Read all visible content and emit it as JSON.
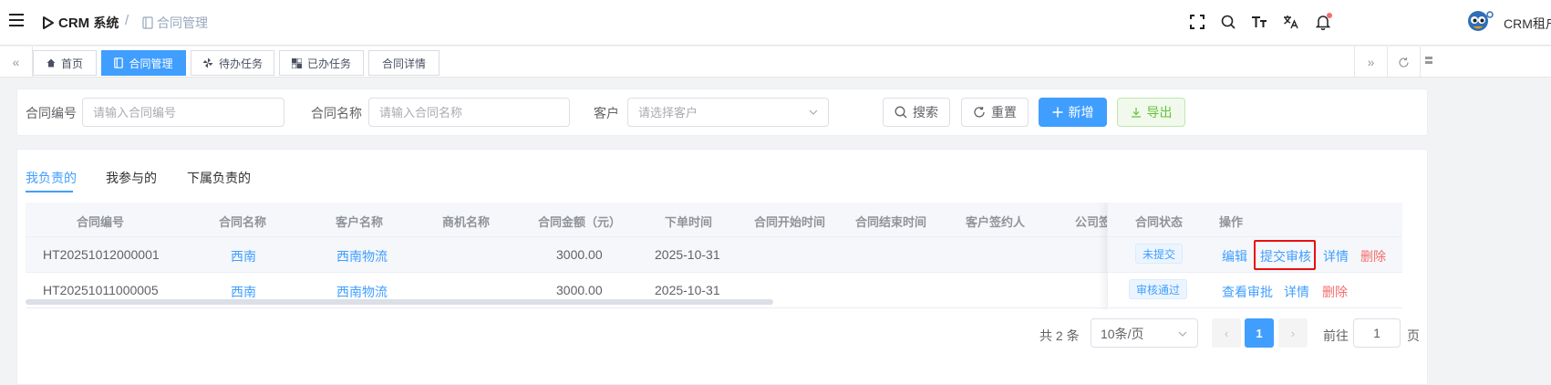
{
  "header": {
    "logo_text": "CRM",
    "logo_suffix": "系统",
    "breadcrumb": "合同管理",
    "user_name": "CRM租户",
    "icons": [
      "fullscreen-icon",
      "search-icon",
      "font-size-icon",
      "translate-icon",
      "bell-icon"
    ]
  },
  "tabs": [
    {
      "label": "首页",
      "icon": "home-icon"
    },
    {
      "label": "合同管理",
      "icon": "document-icon",
      "active": true
    },
    {
      "label": "待办任务",
      "icon": "pinwheel-icon"
    },
    {
      "label": "已办任务",
      "icon": "checkerboard-icon"
    },
    {
      "label": "合同详情",
      "icon": ""
    }
  ],
  "search": {
    "contract_no_label": "合同编号",
    "contract_no_placeholder": "请输入合同编号",
    "contract_name_label": "合同名称",
    "contract_name_placeholder": "请输入合同名称",
    "customer_label": "客户",
    "customer_placeholder": "请选择客户",
    "search_btn": "搜索",
    "reset_btn": "重置",
    "add_btn": "新增",
    "export_btn": "导出"
  },
  "subtabs": [
    "我负责的",
    "我参与的",
    "下属负责的"
  ],
  "table": {
    "columns": [
      "合同编号",
      "合同名称",
      "客户名称",
      "商机名称",
      "合同金额（元）",
      "下单时间",
      "合同开始时间",
      "合同结束时间",
      "客户签约人",
      "公司签",
      "合同状态",
      "操作"
    ],
    "rows": [
      {
        "contract_no": "HT20251012000001",
        "name": "西南",
        "customer": "西南物流",
        "opportunity": "",
        "amount": "3000.00",
        "order_date": "2025-10-31",
        "status": "未提交",
        "actions": [
          "编辑",
          "提交审核",
          "详情",
          "删除"
        ]
      },
      {
        "contract_no": "HT20251011000005",
        "name": "西南",
        "customer": "西南物流",
        "opportunity": "",
        "amount": "3000.00",
        "order_date": "2025-10-31",
        "status": "审核通过",
        "actions": [
          "查看审批",
          "详情",
          "删除"
        ]
      }
    ]
  },
  "pagination": {
    "total_text": "共 2 条",
    "page_size": "10条/页",
    "current_page": "1",
    "goto_label": "前往",
    "goto_value": "1",
    "page_suffix": "页"
  },
  "colors": {
    "primary": "#409eff",
    "danger": "#f56c6c",
    "success": "#67c23a",
    "highlight": "#e81010"
  }
}
